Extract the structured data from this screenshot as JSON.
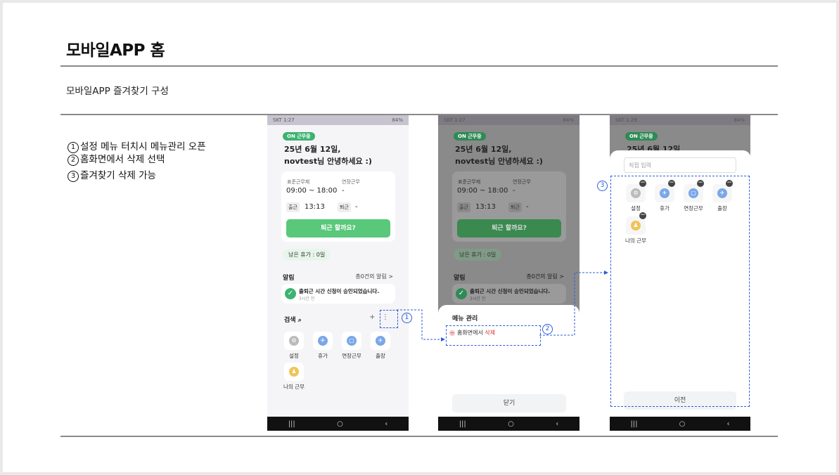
{
  "title": "모바일APP 홈",
  "subtitle": "모바일APP 즐겨찾기 구성",
  "steps": [
    {
      "num": "1",
      "text": "설정 메뉴 터치시 메뉴관리 오픈"
    },
    {
      "num": "2",
      "text": "홈화면에서 삭제 선택"
    },
    {
      "num": "3",
      "text": "즐겨찾기 삭제 가능"
    }
  ],
  "phone": {
    "status_left_1": "SKT 1:27",
    "status_left_2": "SKT 1:27",
    "status_left_3": "SKT 1:29",
    "status_right": "84%",
    "on_badge": "ON 근무중",
    "greet_line1": "25년 6월 12일,",
    "greet_line2": "novtest님 안녕하세요 :)",
    "work_type_label": "표준근무제",
    "overtime_label": "연장근무",
    "work_hours": "09:00 ~ 18:00",
    "overtime_value": "-",
    "checkin_label": "출근",
    "checkin_time": "13:13",
    "checkout_label": "퇴근",
    "checkout_value": "-",
    "leave_button": "퇴근 할까요?",
    "vacation": "남은 휴가 : 0일",
    "alarm_label": "알림",
    "alarm_count": "총0건의 알림 >",
    "notice_title": "출퇴근 시간 신청이 승인되었습니다.",
    "notice_time": "3시간 전",
    "search_label": "검색",
    "favorites": [
      "설정",
      "휴가",
      "연장근무",
      "출장",
      "나의 근무"
    ],
    "menu_sheet_title": "메뉴 관리",
    "menu_item_prefix": "홈화면에서 ",
    "menu_item_delete": "삭제",
    "close_button": "닫기",
    "direct_input_placeholder": "직접 입력",
    "prev_button": "이전"
  },
  "callouts": [
    "1",
    "2",
    "3"
  ],
  "colors": {
    "accent": "#2b5fd9",
    "green": "#5ac87a",
    "delete": "#d9302c"
  }
}
